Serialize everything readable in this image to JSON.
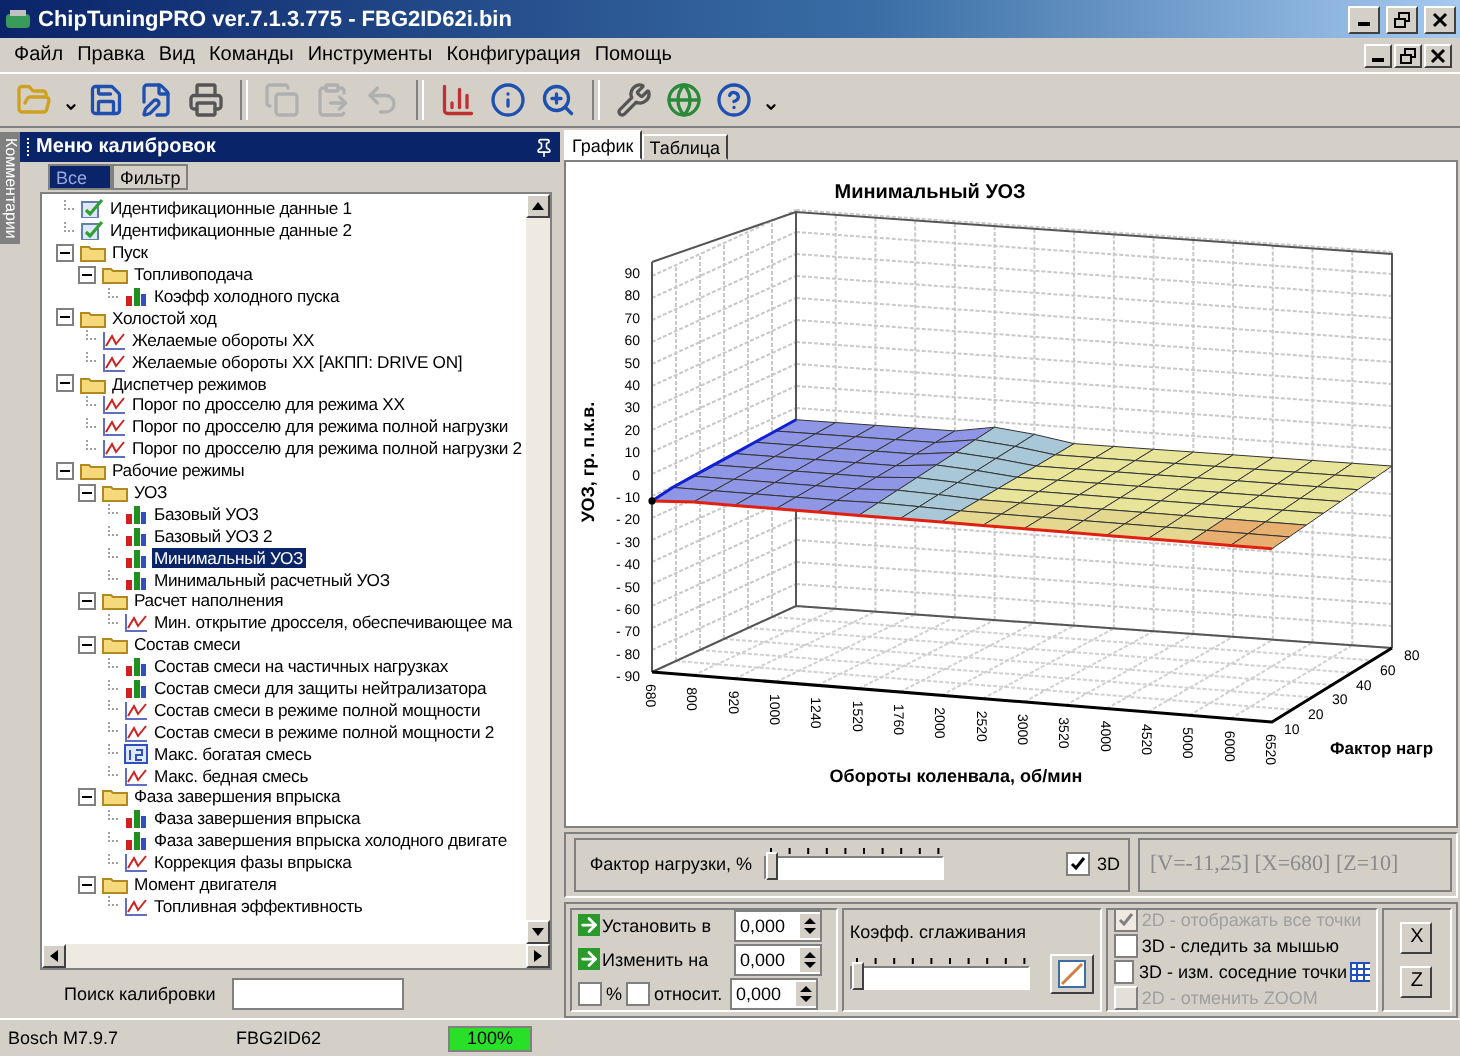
{
  "window": {
    "title": "ChipTuningPRO ver.7.1.3.775 - FBG2ID62i.bin"
  },
  "menu": [
    "Файл",
    "Правка",
    "Вид",
    "Команды",
    "Инструменты",
    "Конфигурация",
    "Помощь"
  ],
  "toolbar": [
    {
      "kind": "button",
      "disabled": false
    },
    {
      "kind": "dropdown",
      "disabled": false
    },
    {
      "kind": "button",
      "disabled": false
    },
    {
      "kind": "button",
      "disabled": false
    },
    {
      "kind": "button",
      "disabled": false
    },
    {
      "kind": "separator"
    },
    {
      "kind": "button",
      "disabled": true
    },
    {
      "kind": "button",
      "disabled": true
    },
    {
      "kind": "button",
      "disabled": true
    },
    {
      "kind": "separator"
    },
    {
      "kind": "button",
      "disabled": false
    },
    {
      "kind": "button",
      "disabled": false
    },
    {
      "kind": "button",
      "disabled": false
    },
    {
      "kind": "separator"
    },
    {
      "kind": "button",
      "disabled": false
    },
    {
      "kind": "button",
      "disabled": false
    },
    {
      "kind": "button",
      "disabled": false
    },
    {
      "kind": "dropdown",
      "disabled": false
    }
  ],
  "side_tab": "Комментарии",
  "panel": {
    "title": "Меню калибровок",
    "filters": [
      {
        "label": "Все",
        "selected": true
      },
      {
        "label": "Фильтр",
        "selected": false
      }
    ]
  },
  "tree": {
    "items": [
      {
        "label": "Идентификационные данные 1",
        "kind": "ident",
        "selected": false
      },
      {
        "label": "Идентификационные данные 2",
        "kind": "ident",
        "selected": false
      },
      {
        "label": "Пуск",
        "kind": "folder",
        "expanded": true,
        "selected": false,
        "children": [
          {
            "label": "Топливоподача",
            "kind": "folder",
            "expanded": true,
            "selected": false,
            "children": [
              {
                "label": "Коэфф холодного пуска",
                "kind": "map3d",
                "selected": false
              }
            ]
          }
        ]
      },
      {
        "label": "Холостой ход",
        "kind": "folder",
        "expanded": true,
        "selected": false,
        "children": [
          {
            "label": "Желаемые обороты ХХ",
            "kind": "map2d",
            "selected": false
          },
          {
            "label": "Желаемые обороты ХХ [АКПП: DRIVE ON]",
            "kind": "map2d",
            "selected": false
          }
        ]
      },
      {
        "label": "Диспетчер режимов",
        "kind": "folder",
        "expanded": true,
        "selected": false,
        "children": [
          {
            "label": "Порог по дросселю для режима ХХ",
            "kind": "map2d",
            "selected": false
          },
          {
            "label": "Порог по дросселю для режима полной нагрузки",
            "kind": "map2d",
            "selected": false
          },
          {
            "label": "Порог по дросселю для режима полной нагрузки 2",
            "kind": "map2d",
            "selected": false
          }
        ]
      },
      {
        "label": "Рабочие режимы",
        "kind": "folder",
        "expanded": true,
        "selected": false,
        "children": [
          {
            "label": "УОЗ",
            "kind": "folder",
            "expanded": true,
            "selected": false,
            "children": [
              {
                "label": "Базовый УОЗ",
                "kind": "map3d",
                "selected": false
              },
              {
                "label": "Базовый УОЗ 2",
                "kind": "map3d",
                "selected": false
              },
              {
                "label": "Минимальный УОЗ",
                "kind": "map3d",
                "selected": true
              },
              {
                "label": "Минимальный расчетный УОЗ",
                "kind": "map3d",
                "selected": false
              }
            ]
          },
          {
            "label": "Расчет наполнения",
            "kind": "folder",
            "expanded": true,
            "selected": false,
            "children": [
              {
                "label": "Мин. открытие дросселя, обеспечивающее ма",
                "kind": "map2d",
                "selected": false
              }
            ]
          },
          {
            "label": "Состав смеси",
            "kind": "folder",
            "expanded": true,
            "selected": false,
            "children": [
              {
                "label": "Состав смеси на частичных нагрузках",
                "kind": "map3d",
                "selected": false
              },
              {
                "label": "Состав смеси для защиты нейтрализатора",
                "kind": "map3d",
                "selected": false
              },
              {
                "label": "Состав смеси в режиме полной мощности",
                "kind": "map2d",
                "selected": false
              },
              {
                "label": "Состав смеси в режиме полной мощности 2",
                "kind": "map2d",
                "selected": false
              },
              {
                "label": "Макс. богатая смесь",
                "kind": "value",
                "selected": false
              },
              {
                "label": "Макс. бедная смесь",
                "kind": "map2d",
                "selected": false
              }
            ]
          },
          {
            "label": "Фаза завершения впрыска",
            "kind": "folder",
            "expanded": true,
            "selected": false,
            "children": [
              {
                "label": "Фаза завершения впрыска",
                "kind": "map3d",
                "selected": false
              },
              {
                "label": "Фаза завершения впрыска холодного двигате",
                "kind": "map3d",
                "selected": false
              },
              {
                "label": "Коррекция фазы впрыска",
                "kind": "map2d",
                "selected": false
              }
            ]
          },
          {
            "label": "Момент двигателя",
            "kind": "folder",
            "expanded": true,
            "selected": false,
            "children": [
              {
                "label": "Топливная эффективность",
                "kind": "map2d",
                "selected": false
              }
            ]
          }
        ]
      }
    ]
  },
  "search": {
    "label": "Поиск калибровки"
  },
  "view_tabs": [
    {
      "label": "График",
      "selected": true
    },
    {
      "label": "Таблица",
      "selected": false
    }
  ],
  "chart": {
    "title": "Минимальный УОЗ",
    "ylabel": "УОЗ, гр. п.к.в.",
    "xlabel": "Обороты коленвала, об/мин",
    "zlabel": "Фактор нагр",
    "yticks": [
      "90",
      "80",
      "70",
      "60",
      "50",
      "40",
      "30",
      "20",
      "10",
      "0",
      "- 10",
      "- 20",
      "- 30",
      "- 40",
      "- 50",
      "- 60",
      "- 70",
      "- 80",
      "- 90"
    ],
    "xticks": [
      "680",
      "800",
      "920",
      "1000",
      "1240",
      "1520",
      "1760",
      "2000",
      "2520",
      "3000",
      "3520",
      "4000",
      "4520",
      "5000",
      "6000",
      "6520"
    ],
    "zticks": [
      "10",
      "20",
      "30",
      "40",
      "60",
      "80"
    ]
  },
  "load_bar": {
    "label": "Фактор нагрузки, %",
    "level": 0,
    "three_d": {
      "label": "3D",
      "checked": true
    },
    "readout": "[V=-11,25] [X=680] [Z=10]"
  },
  "edit": {
    "set": {
      "label": "Установить в",
      "value": "0,000"
    },
    "change": {
      "label": "Изменить на",
      "value": "0,000"
    },
    "percent": {
      "label": "%",
      "checked": false
    },
    "relative": {
      "label": "относит.",
      "checked": false
    },
    "relative_value": "0,000"
  },
  "smoothing": {
    "label": "Коэфф. сглаживания",
    "level": 0
  },
  "options": [
    {
      "kind": "checkbox",
      "label": "2D - отображать все точки",
      "checked": true,
      "disabled": true
    },
    {
      "kind": "checkbox",
      "label": "3D - следить за мышью",
      "checked": false,
      "disabled": false
    },
    {
      "kind": "checkbox",
      "label": "3D - изм. соседние точки",
      "checked": false,
      "disabled": false
    },
    {
      "kind": "toggle",
      "label": "2D - отменить ZOOM",
      "checked": false,
      "disabled": true
    }
  ],
  "axis_buttons": [
    "X",
    "Z"
  ],
  "status_bar": {
    "cells": [
      "Bosch M7.9.7",
      "FBG2ID62"
    ],
    "progress": {
      "label": "100%",
      "level": 1
    }
  }
}
